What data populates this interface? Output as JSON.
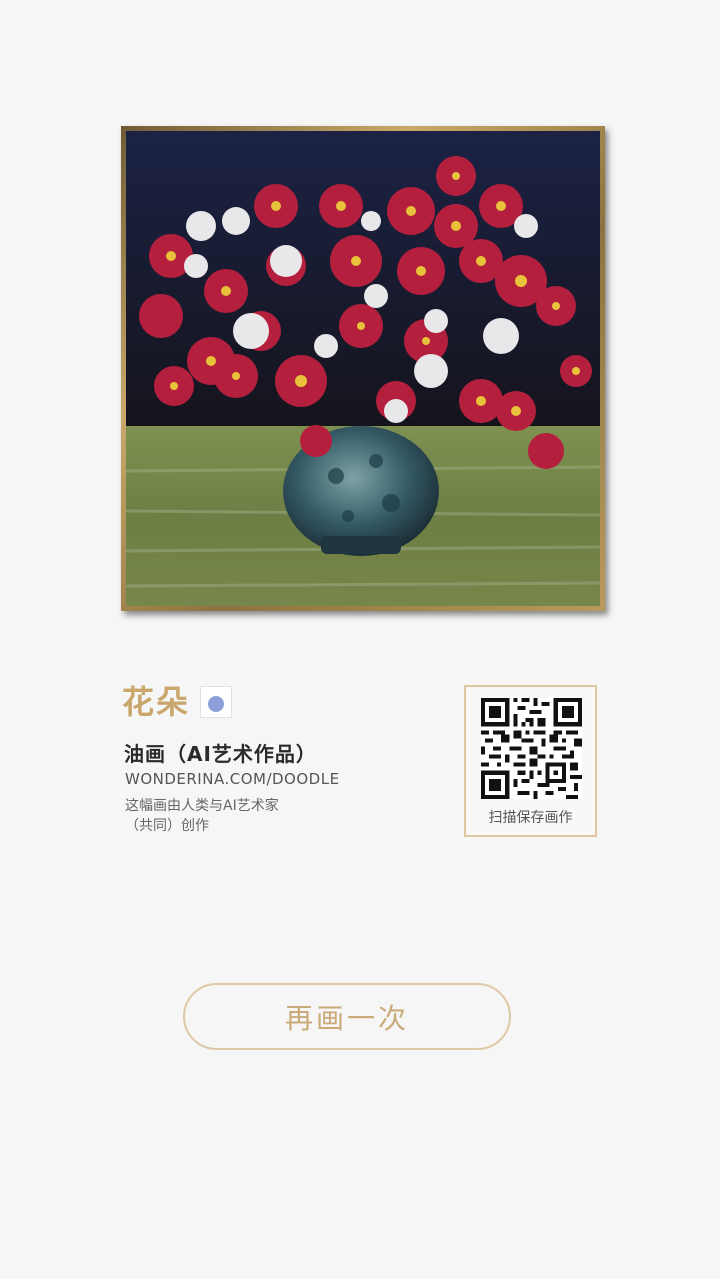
{
  "artwork": {
    "title": "花朵",
    "medium": "油画（AI艺术作品）",
    "site": "WONDERINA.COM/DOODLE",
    "description_line1": "这幅画由人类与AI艺术家",
    "description_line2": "（共同）创作"
  },
  "qr": {
    "caption": "扫描保存画作"
  },
  "actions": {
    "retry_label": "再画一次"
  },
  "colors": {
    "accent_gold": "#c9a66b",
    "button_border": "#ddc9a5",
    "dot_blue": "#8ca1d8",
    "background": "#f6f6f6"
  }
}
